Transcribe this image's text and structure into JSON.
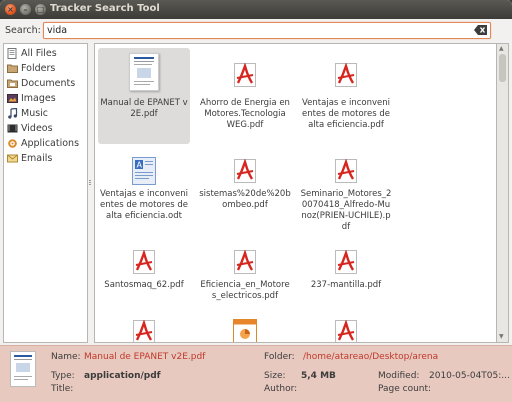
{
  "window": {
    "title": "Tracker Search Tool",
    "controls": {
      "close": "×",
      "minimize": "–",
      "maximize": "□"
    }
  },
  "search": {
    "label": "Search:",
    "value": "vida",
    "clear_icon": "clear-icon"
  },
  "sidebar": {
    "items": [
      {
        "label": "All Files",
        "icon": "all-files-icon"
      },
      {
        "label": "Folders",
        "icon": "folder-icon"
      },
      {
        "label": "Documents",
        "icon": "documents-icon"
      },
      {
        "label": "Images",
        "icon": "images-icon"
      },
      {
        "label": "Music",
        "icon": "music-icon"
      },
      {
        "label": "Videos",
        "icon": "videos-icon"
      },
      {
        "label": "Applications",
        "icon": "applications-icon"
      },
      {
        "label": "Emails",
        "icon": "emails-icon"
      }
    ]
  },
  "results": {
    "files": [
      {
        "name": "Manual de EPANET v2E.pdf",
        "type": "doc-thumb",
        "selected": true
      },
      {
        "name": "Ahorro de Energia en Motores.Tecnologia WEG.pdf",
        "type": "pdf"
      },
      {
        "name": "Ventajas e inconvenientes de motores de alta eficiencia.pdf",
        "type": "pdf"
      },
      {
        "name": "Ventajas e inconvenientes de motores de alta eficiencia.odt",
        "type": "odt"
      },
      {
        "name": "sistemas%20de%20bombeo.pdf",
        "type": "pdf"
      },
      {
        "name": "Seminario_Motores_20070418_Alfredo-Munoz(PRIEN-UCHILE).pdf",
        "type": "pdf"
      },
      {
        "name": "Santosmaq_62.pdf",
        "type": "pdf"
      },
      {
        "name": "Eficiencia_en_Motores_electricos.pdf",
        "type": "pdf"
      },
      {
        "name": "237-mantilla.pdf",
        "type": "pdf"
      },
      {
        "name": "",
        "type": "pdf"
      },
      {
        "name": "",
        "type": "odp"
      },
      {
        "name": "",
        "type": "pdf"
      }
    ]
  },
  "details": {
    "name_label": "Name:",
    "name_value": "Manual de EPANET v2E.pdf",
    "type_label": "Type:",
    "type_value": "application/pdf",
    "title_label": "Title:",
    "title_value": "",
    "folder_label": "Folder:",
    "folder_value": "/home/atareao/Desktop/arena",
    "size_label": "Size:",
    "size_value": "5,4 MB",
    "author_label": "Author:",
    "author_value": "",
    "modified_label": "Modified:",
    "modified_value": "2010-05-04T05:...",
    "pagecount_label": "Page count:",
    "pagecount_value": ""
  },
  "colors": {
    "accent": "#e1885a",
    "link": "#c0392b",
    "details_bg": "#e7c9bf",
    "pdf_red": "#d7261f"
  }
}
